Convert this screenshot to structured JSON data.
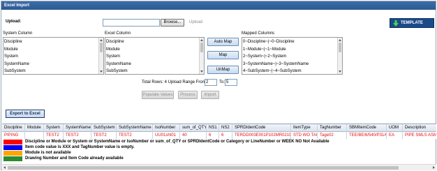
{
  "title": "Excel Import",
  "upload": {
    "label": "Upload:",
    "browse_label": "Browse...",
    "upload_link": "Upload"
  },
  "template_button": {
    "label": "TEMPLATE",
    "icon": "download-arrow-icon",
    "color": "#1c4b8a"
  },
  "system_column": {
    "label": "System Column",
    "items": [
      "Discipline",
      "Module",
      "System",
      "SystemName",
      "SubSystem"
    ]
  },
  "excel_column": {
    "label": "Excel Column",
    "items": [
      "Discipline",
      "Module",
      "System",
      "SystemName",
      "SubSystem"
    ]
  },
  "mapped_columns": {
    "label": "Mapped Columns",
    "items": [
      "0~Discipline~|~0~Discipline",
      "1~Module~|~1~Module",
      "2~System~|~2~System",
      "3~SystemName~|~3~SystemName",
      "4~SubSystem~|~4~SubSystem"
    ]
  },
  "map_buttons": {
    "auto_map": "Auto Map",
    "map": "Map",
    "unmap": "UnMap"
  },
  "range": {
    "text": "Total Rows: 4 Upload Range From:",
    "from": "2",
    "to_label": "To:",
    "to": "5"
  },
  "actions": {
    "populate": "Populate Values",
    "process": "Process",
    "import": "Import"
  },
  "export_button": "Export to Excel",
  "grid": {
    "columns": [
      "Discipline",
      "Module",
      "System",
      "SystemName",
      "SubSystem",
      "SubSystemName",
      "IsoNumber",
      "sum_of_QTY",
      "NS1",
      "NS2",
      "SPRDIdentCode",
      "ItemType",
      "TagNumber",
      "SBMItemCode",
      "UOM",
      "Description"
    ],
    "row": [
      "PIPING",
      "",
      "TEST2",
      "TEST2",
      "TEST2",
      "TEST2",
      "UU01sht01",
      "40",
      "6",
      "6",
      "TERDD003E001P102MR0219",
      "STD WO TAG",
      "Tage02",
      "TEE/BE/6/540/P31/C01",
      "EA",
      "PIPE SMLS ASME B"
    ]
  },
  "legend": [
    {
      "color": "#ff0000",
      "text": "Discipline or Module or System or SystemName or IsoNumber or sum_of_QTY or SPRDIdentCode or Category or LineNumber or WEEK NO Not Available"
    },
    {
      "color": "#0000ff",
      "text": "Item code value is XXX and TagNumber value is empty."
    },
    {
      "color": "#ffa500",
      "text": "Module is not available"
    },
    {
      "color": "#2e8b2e",
      "text": "Drawing Number and Item Code already available"
    }
  ]
}
